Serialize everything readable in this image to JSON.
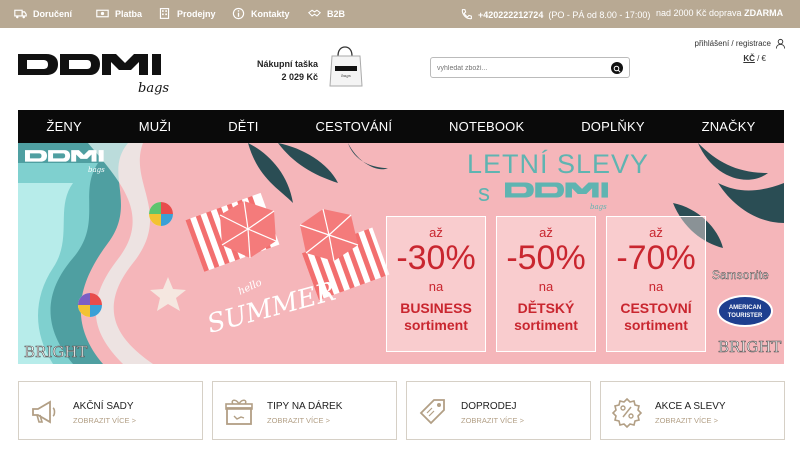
{
  "topbar": {
    "items": [
      {
        "label": "Doručení",
        "icon": "truck-icon"
      },
      {
        "label": "Platba",
        "icon": "cash-icon"
      },
      {
        "label": "Prodejny",
        "icon": "building-icon"
      },
      {
        "label": "Kontakty",
        "icon": "info-icon"
      },
      {
        "label": "B2B",
        "icon": "handshake-icon"
      }
    ],
    "phone": "+420222212724",
    "hours": "(PO - PÁ od 8.00 - 17:00)",
    "free_shipping_prefix": "nad 2000 Kč doprava",
    "free_shipping_word": "ZDARMA",
    "color": "#b8a993"
  },
  "header": {
    "logo_text": "DOMI",
    "logo_sub": "bags",
    "cart_label": "Nákupní taška",
    "cart_total": "2 029 Kč",
    "search_placeholder": "vyhledat zboží...",
    "login_text": "přihlášení / registrace",
    "currency_active": "KČ",
    "currency_other": "€"
  },
  "nav": [
    "ŽENY",
    "MUŽI",
    "DĚTI",
    "CESTOVÁNÍ",
    "NOTEBOOK",
    "DOPLŇKY",
    "ZNAČKY"
  ],
  "banner": {
    "headline": "LETNÍ SLEVY",
    "headline_s": "s",
    "brand": "DOMI",
    "brand_sub": "bags",
    "hello": "hello",
    "summer": "SUMMER",
    "promos": [
      {
        "az": "až",
        "pct": "-30%",
        "na": "na",
        "cat": "BUSINESS",
        "sort": "sortiment"
      },
      {
        "az": "až",
        "pct": "-50%",
        "na": "na",
        "cat": "DĚTSKÝ",
        "sort": "sortiment"
      },
      {
        "az": "až",
        "pct": "-70%",
        "na": "na",
        "cat": "CESTOVNÍ",
        "sort": "sortiment"
      }
    ],
    "brands": {
      "samsonite": "Samsonite",
      "american": "AMERICAN",
      "tourister": "TOURISTER",
      "bright_right": "BRIGHT",
      "bright_left": "BRIGHT"
    },
    "accent": "#5fb4b1",
    "promo_color": "#c9262f"
  },
  "cards": [
    {
      "title": "AKČNÍ SADY",
      "link": "ZOBRAZIT VÍCE >",
      "icon": "megaphone-icon"
    },
    {
      "title": "TIPY NA DÁREK",
      "link": "ZOBRAZIT VÍCE >",
      "icon": "gift-icon"
    },
    {
      "title": "DOPRODEJ",
      "link": "ZOBRAZIT VÍCE >",
      "icon": "tag-icon"
    },
    {
      "title": "AKCE A SLEVY",
      "link": "ZOBRAZIT VÍCE >",
      "icon": "percent-icon"
    }
  ]
}
